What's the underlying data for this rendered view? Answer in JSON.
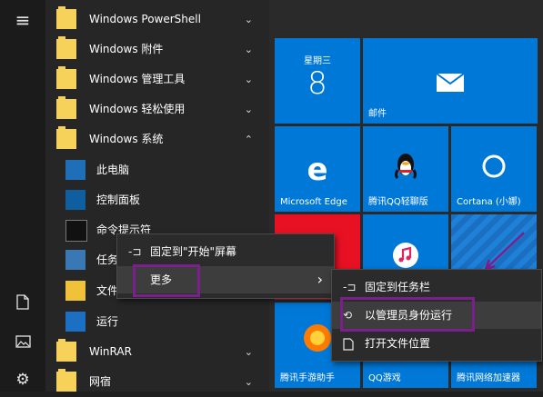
{
  "rail": {
    "items": [
      {
        "icon": "hamburger-menu-icon",
        "glyph": "≡"
      },
      {
        "icon": "document-icon",
        "glyph": "🗋"
      },
      {
        "icon": "pictures-icon",
        "glyph": "🖼"
      },
      {
        "icon": "settings-gear-icon",
        "glyph": "⚙"
      }
    ]
  },
  "app_list": {
    "folders": [
      {
        "label": "Windows PowerShell",
        "chevron": "⌄"
      },
      {
        "label": "Windows 附件",
        "chevron": "⌄"
      },
      {
        "label": "Windows 管理工具",
        "chevron": "⌄"
      },
      {
        "label": "Windows 轻松使用",
        "chevron": "⌄"
      },
      {
        "label": "Windows 系统",
        "chevron": "⌃"
      }
    ],
    "sub_items": [
      {
        "label": "此电脑"
      },
      {
        "label": "控制面板"
      },
      {
        "label": "命令提示符"
      },
      {
        "label": "任务管理器"
      },
      {
        "label": "文件资源管理器"
      },
      {
        "label": "运行"
      }
    ],
    "bottom_folders": [
      {
        "label": "WinRAR",
        "chevron": "⌄"
      },
      {
        "label": "网宿",
        "chevron": "⌄"
      }
    ]
  },
  "tiles": {
    "calendar": {
      "weekday": "星期三",
      "day": "8"
    },
    "mail": {
      "label": "邮件"
    },
    "edge": {
      "label": "Microsoft Edge"
    },
    "qq": {
      "label": "腾讯QQ轻聊版"
    },
    "cortana": {
      "label": "Cortana (小娜)"
    },
    "shoujizhushou": {
      "label": "腾讯手游助手"
    },
    "qqgame": {
      "label": "QQ游戏"
    },
    "jiasuqi": {
      "label": "腾讯网络加速器"
    }
  },
  "context_menu": {
    "items": [
      {
        "icon": "pin-icon",
        "label": "固定到\"开始\"屏幕"
      },
      {
        "icon": "",
        "label": "更多",
        "arrow": "›"
      }
    ]
  },
  "submenu": {
    "items": [
      {
        "icon": "pin-icon",
        "label": "固定到任务栏"
      },
      {
        "icon": "run-as-admin-icon",
        "label": "以管理员身份运行"
      },
      {
        "icon": "open-file-location-icon",
        "label": "打开文件位置"
      }
    ]
  },
  "colors": {
    "tile_blue": "#0078d7",
    "highlight_purple": "#7a1f8c",
    "folder_yellow": "#f7d25b"
  }
}
